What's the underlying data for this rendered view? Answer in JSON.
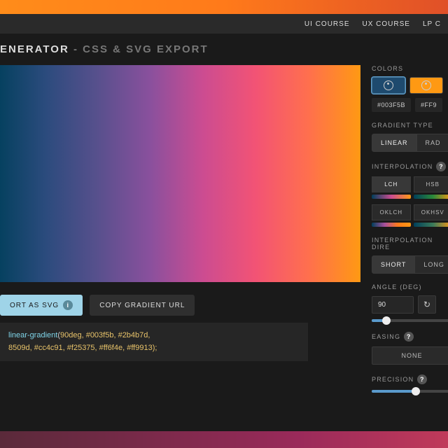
{
  "nav": {
    "ui_course": "UI COURSE",
    "ux_course": "UX COURSE",
    "lp": "LP C"
  },
  "header": {
    "title": "ENERATOR",
    "subtitle": " - CSS & SVG EXPORT"
  },
  "actions": {
    "export_svg": "ORT AS SVG",
    "copy_url": "COPY GRADIENT URL"
  },
  "code": {
    "fn": "linear-gradient",
    "args_line1": "90deg, #003f5b, #2b4b7d,",
    "args_line2": "8509d, #cc4c91, #f25375, #ff6f4e, #ff9913);"
  },
  "colors": {
    "label": "COLORS",
    "hex1": "#003F5B",
    "hex2": "#FF9"
  },
  "gradient_type": {
    "label": "GRADIENT TYPE",
    "linear": "LINEAR",
    "radial": "RAD"
  },
  "interpolation": {
    "label": "INTERPOLATION",
    "lch": "LCH",
    "hsb": "HSB",
    "oklch": "OKLCH",
    "okhsv": "OKHSV"
  },
  "interp_dir": {
    "label": "INTERPOLATION DIRE",
    "short": "SHORT",
    "long": "LONG"
  },
  "angle": {
    "label": "ANGLE (DEG)",
    "value": "90"
  },
  "easing": {
    "label": "EASING",
    "none": "NONE"
  },
  "precision": {
    "label": "PRECISION"
  }
}
